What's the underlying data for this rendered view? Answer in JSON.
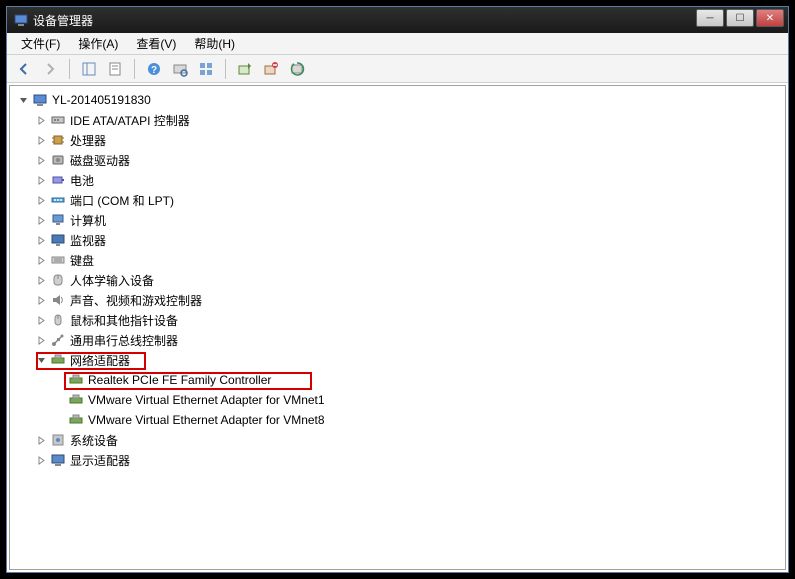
{
  "window": {
    "title": "设备管理器"
  },
  "menu": {
    "file": "文件(F)",
    "action": "操作(A)",
    "view": "查看(V)",
    "help": "帮助(H)"
  },
  "tree": {
    "root": "YL-201405191830",
    "nodes": [
      {
        "label": "IDE ATA/ATAPI 控制器",
        "icon": "ide"
      },
      {
        "label": "处理器",
        "icon": "cpu"
      },
      {
        "label": "磁盘驱动器",
        "icon": "disk"
      },
      {
        "label": "电池",
        "icon": "battery"
      },
      {
        "label": "端口 (COM 和 LPT)",
        "icon": "port"
      },
      {
        "label": "计算机",
        "icon": "computer"
      },
      {
        "label": "监视器",
        "icon": "monitor"
      },
      {
        "label": "键盘",
        "icon": "keyboard"
      },
      {
        "label": "人体学输入设备",
        "icon": "hid"
      },
      {
        "label": "声音、视频和游戏控制器",
        "icon": "sound"
      },
      {
        "label": "鼠标和其他指针设备",
        "icon": "mouse"
      },
      {
        "label": "通用串行总线控制器",
        "icon": "usb"
      }
    ],
    "network": {
      "label": "网络适配器",
      "children": [
        "Realtek PCIe FE Family Controller",
        "VMware Virtual Ethernet Adapter for VMnet1",
        "VMware Virtual Ethernet Adapter for VMnet8"
      ]
    },
    "tail": [
      {
        "label": "系统设备",
        "icon": "system"
      },
      {
        "label": "显示适配器",
        "icon": "display"
      }
    ]
  }
}
